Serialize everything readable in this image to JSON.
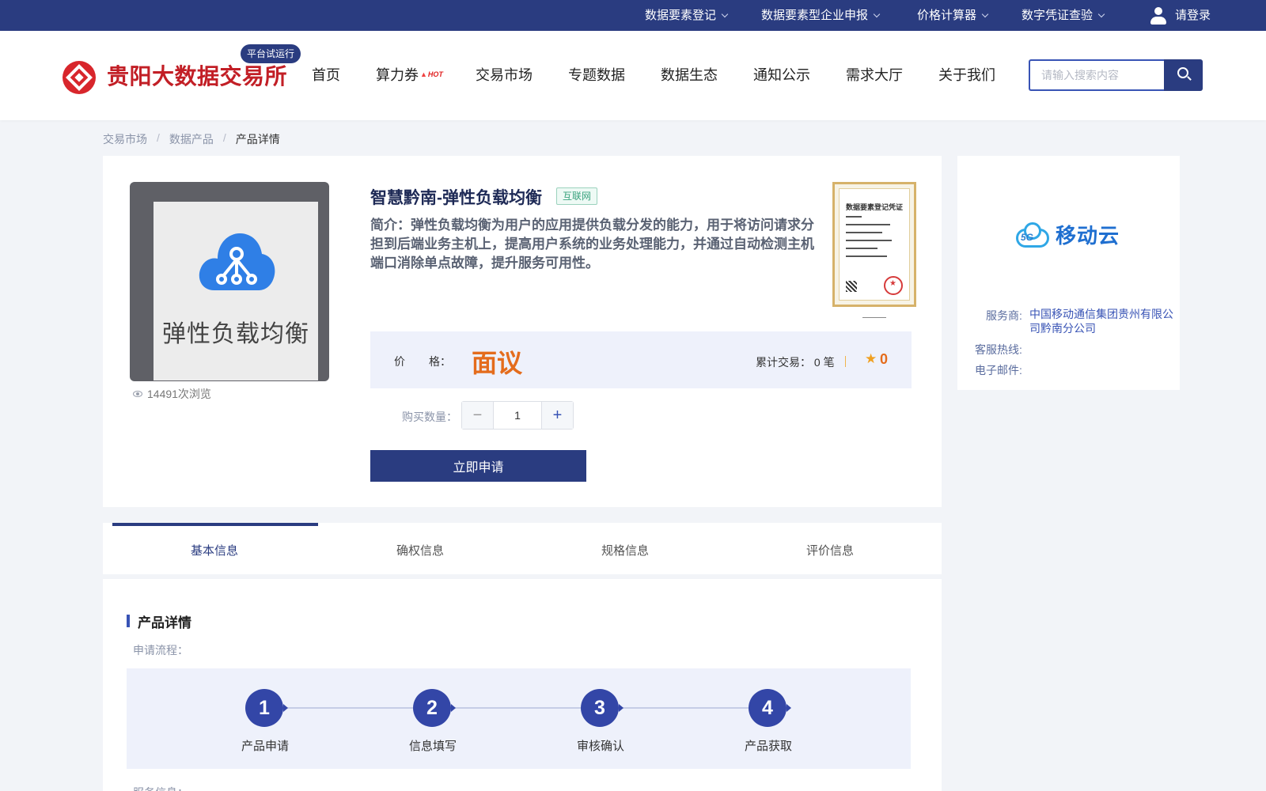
{
  "topbar": {
    "items": [
      {
        "label": "数据要素登记"
      },
      {
        "label": "数据要素型企业申报"
      },
      {
        "label": "价格计算器"
      },
      {
        "label": "数字凭证查验"
      }
    ],
    "login_label": "请登录"
  },
  "header": {
    "logo_text": "贵阳大数据交易所",
    "pilot_badge": "平台试运行",
    "nav": [
      "首页",
      "算力券",
      "交易市场",
      "专题数据",
      "数据生态",
      "通知公示",
      "需求大厅",
      "关于我们"
    ],
    "hot_badge": "HOT",
    "search_placeholder": "请输入搜索内容"
  },
  "breadcrumb": {
    "items": [
      "交易市场",
      "数据产品",
      "产品详情"
    ],
    "separator": "/"
  },
  "product": {
    "thumbnail_label": "弹性负载均衡",
    "views": "14491次浏览",
    "title": "智慧黔南-弹性负载均衡",
    "tag": "互联网",
    "description": "简介：弹性负载均衡为用户的应用提供负载分发的能力，用于将访问请求分担到后端业务主机上，提高用户系统的业务处理能力，并通过自动检测主机端口消除单点故障，提升服务可用性。",
    "certificate_title": "数据要素登记凭证",
    "price_label_a": "价",
    "price_label_b": "格：",
    "price_value": "面议",
    "deals": "累计交易： 0 笔",
    "rating": "0",
    "quantity_label": "购买数量：",
    "quantity_value": "1",
    "apply_label": "立即申请"
  },
  "vendor": {
    "logo_text": "移动云",
    "logo_5g": "5G",
    "provider_label": "服务商:",
    "provider_value": "中国移动通信集团贵州有限公司黔南分公司",
    "hotline_label": "客服热线:",
    "email_label": "电子邮件:"
  },
  "tabs": [
    "基本信息",
    "确权信息",
    "规格信息",
    "评价信息"
  ],
  "detail": {
    "section_title": "产品详情",
    "flow_label": "申请流程：",
    "steps": [
      {
        "num": "1",
        "label": "产品申请"
      },
      {
        "num": "2",
        "label": "信息填写"
      },
      {
        "num": "3",
        "label": "审核确认"
      },
      {
        "num": "4",
        "label": "产品获取"
      }
    ],
    "next_label": "服务信息："
  },
  "colors": {
    "primary": "#2a3c80",
    "accent_blue": "#3853b5",
    "price_orange": "#e46c1c",
    "brand_red": "#c21f26",
    "tag_green": "#3aa37e"
  }
}
